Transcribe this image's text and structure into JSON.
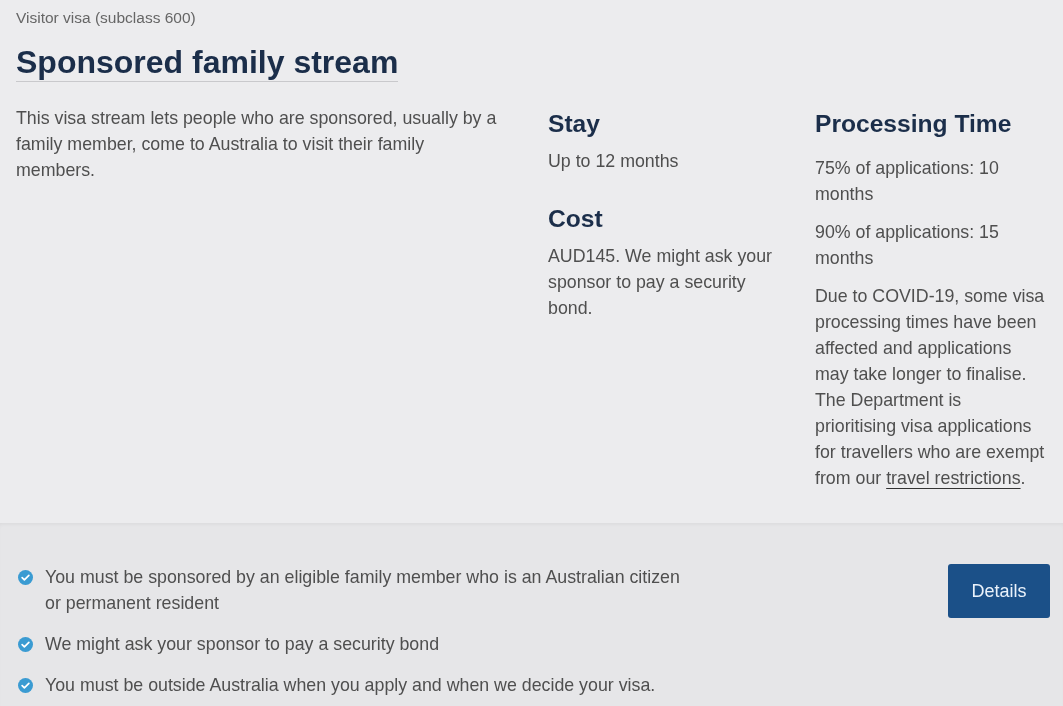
{
  "breadcrumb": "Visitor visa (subclass 600)",
  "title": "Sponsored family stream",
  "description": "This visa stream lets people who are sponsored, usually by a family member, come to Australia to visit their family members.",
  "facts": [
    {
      "heading": "Stay",
      "paragraphs": [
        "Up to 12 months"
      ]
    },
    {
      "heading": "Cost",
      "paragraphs": [
        "AUD145. We might ask your sponsor to pay a security bond."
      ]
    }
  ],
  "processing": {
    "heading": "Processing Time",
    "paragraphs": [
      {
        "text": "75% of applications: 10 months"
      },
      {
        "text": "90% of applications: 15 months"
      },
      {
        "text": "Due to COVID-19, some visa processing times have been affected and applications may take longer to finalise. The Department is prioritising visa applications for travellers who are exempt from our ",
        "link": "travel restrictions",
        "after": "."
      }
    ]
  },
  "requirements": [
    "You must be sponsored by an eligible family member who is an Australian citizen or permanent resident",
    "We might ask your sponsor to pay a security bond",
    "You must be outside Australia when you apply and when we decide your visa."
  ],
  "button": "Details"
}
